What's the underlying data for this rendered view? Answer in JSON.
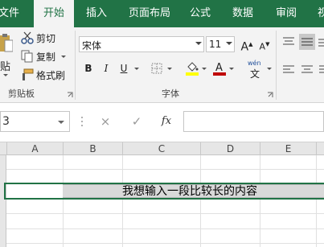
{
  "tabs": [
    {
      "id": "file",
      "label": "文件"
    },
    {
      "id": "start",
      "label": "开始"
    },
    {
      "id": "insert",
      "label": "插入"
    },
    {
      "id": "layout",
      "label": "页面布局"
    },
    {
      "id": "formula",
      "label": "公式"
    },
    {
      "id": "data",
      "label": "数据"
    },
    {
      "id": "review",
      "label": "审阅"
    },
    {
      "id": "view",
      "label": "视"
    }
  ],
  "clipboard": {
    "paste_label": "贴",
    "cut_label": "剪切",
    "copy_label": "复制",
    "format_painter_label": "格式刷",
    "group_label": "剪贴板"
  },
  "font": {
    "name": "宋体",
    "size": "11",
    "bold": "B",
    "italic": "I",
    "underline": "U",
    "grow": "A",
    "shrink": "A",
    "wen": "wén",
    "wen_char": "文",
    "group_label": "字体"
  },
  "formula_bar": {
    "name_box": "3",
    "cancel_icon": "×",
    "enter_icon": "✓",
    "fx": "fx",
    "content": ""
  },
  "columns": [
    "A",
    "B",
    "C",
    "D",
    "E"
  ],
  "cell_text": "我想输入一段比较长的内容",
  "colors": {
    "accent": "#217346",
    "fill_highlight": "#ffff00",
    "font_color": "#c00000"
  }
}
